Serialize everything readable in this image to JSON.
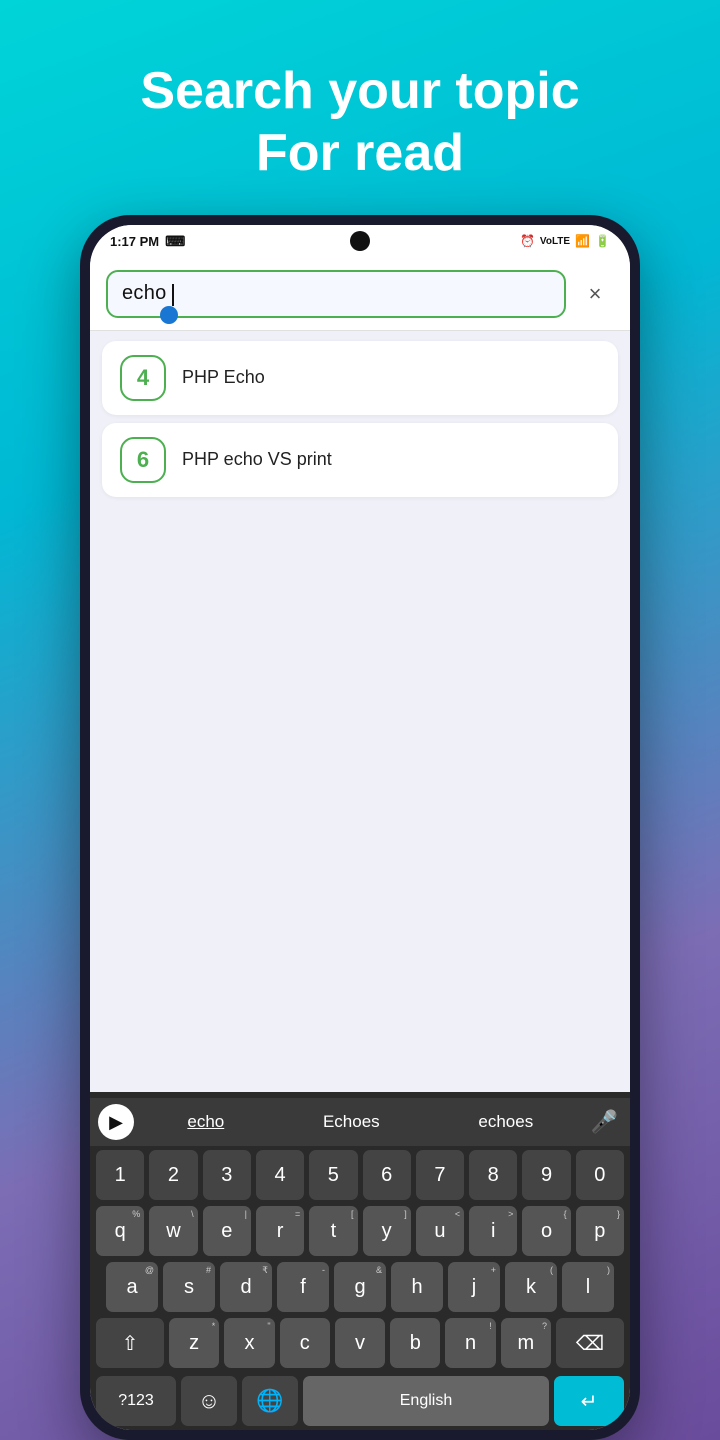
{
  "header": {
    "line1": "Search your topic",
    "line2": "For read"
  },
  "status_bar": {
    "time": "1:17 PM",
    "icons": [
      "keyboard",
      "alarm",
      "volte",
      "signal",
      "battery"
    ]
  },
  "search": {
    "value": "echo",
    "clear_label": "×"
  },
  "results": [
    {
      "badge": "4",
      "label": "PHP Echo"
    },
    {
      "badge": "6",
      "label": "PHP echo VS print"
    }
  ],
  "keyboard": {
    "suggestions": [
      "echo",
      "Echoes",
      "echoes"
    ],
    "rows": {
      "numbers": [
        "1",
        "2",
        "3",
        "4",
        "5",
        "6",
        "7",
        "8",
        "9",
        "0"
      ],
      "row1": [
        {
          "k": "q",
          "s": "%"
        },
        {
          "k": "w",
          "s": "\\"
        },
        {
          "k": "e",
          "s": "|"
        },
        {
          "k": "r",
          "s": "="
        },
        {
          "k": "t",
          "s": "["
        },
        {
          "k": "y",
          "s": "]"
        },
        {
          "k": "u",
          "s": "<"
        },
        {
          "k": "i",
          "s": ">"
        },
        {
          "k": "o",
          "s": "{"
        },
        {
          "k": "p",
          "s": "}"
        }
      ],
      "row2": [
        {
          "k": "a",
          "s": "@"
        },
        {
          "k": "s",
          "s": "#"
        },
        {
          "k": "d",
          "s": "₹"
        },
        {
          "k": "f",
          "s": "-"
        },
        {
          "k": "g",
          "s": "&"
        },
        {
          "k": "h",
          "s": ""
        },
        {
          "k": "j",
          "s": "+"
        },
        {
          "k": "k",
          "s": "("
        },
        {
          "k": "l",
          "s": ")"
        }
      ],
      "row3": [
        {
          "k": "z",
          "s": "*"
        },
        {
          "k": "x",
          "s": "\""
        },
        {
          "k": "c",
          "s": ""
        },
        {
          "k": "v",
          "s": ""
        },
        {
          "k": "b",
          "s": ""
        },
        {
          "k": "n",
          "s": "!"
        },
        {
          "k": "m",
          "s": "?"
        }
      ]
    },
    "bottom": {
      "special": "?123",
      "emoji": "☺",
      "language": "🌐",
      "space_label": "English",
      "enter_icon": "↵"
    }
  }
}
